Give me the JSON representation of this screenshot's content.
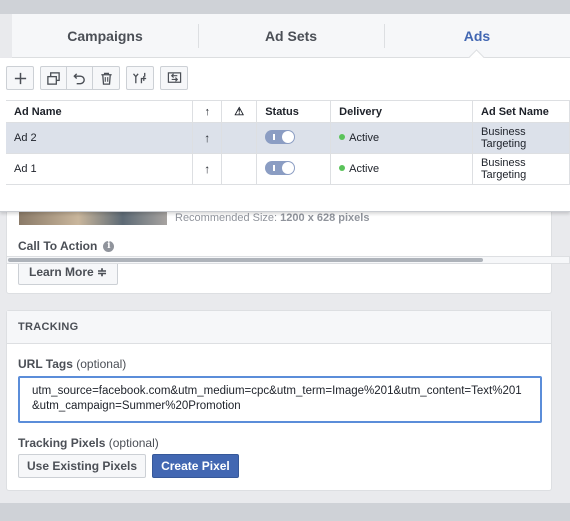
{
  "tabs": [
    {
      "label": "Campaigns",
      "active": false
    },
    {
      "label": "Ad Sets",
      "active": false
    },
    {
      "label": "Ads",
      "active": true
    }
  ],
  "toolbar": {
    "icons": [
      "plus-icon",
      "duplicate-icon",
      "undo-icon",
      "trash-icon",
      "split-icon",
      "export-icon"
    ]
  },
  "table": {
    "columns": [
      "Ad Name",
      "↑",
      "⚠",
      "Status",
      "Delivery",
      "Ad Set Name"
    ],
    "rows": [
      {
        "name": "Ad 2",
        "arrow": "↑",
        "status_on": true,
        "delivery": "Active",
        "ad_set": "Business Targeting",
        "selected": true
      },
      {
        "name": "Ad 1",
        "arrow": "↑",
        "status_on": true,
        "delivery": "Active",
        "ad_set": "Business Targeting",
        "selected": false
      }
    ]
  },
  "creative": {
    "recommended_prefix": "Recommended Size:",
    "recommended_value": "1200 x 628 pixels",
    "cta_label": "Call To Action",
    "cta_value": "Learn More ≑"
  },
  "tracking": {
    "header": "TRACKING",
    "url_label": "URL Tags",
    "url_optional": "(optional)",
    "url_value": "utm_source=facebook.com&utm_medium=cpc&utm_term=Image%201&utm_content=Text%201&utm_campaign=Summer%20Promotion",
    "pixels_label": "Tracking Pixels",
    "pixels_optional": "(optional)",
    "use_existing_label": "Use Existing Pixels",
    "create_pixel_label": "Create Pixel"
  },
  "colors": {
    "accent": "#4267b2",
    "active_dot": "#5ac35a",
    "selected_row": "#dce1ea",
    "focus_border": "#5b8dd9"
  }
}
